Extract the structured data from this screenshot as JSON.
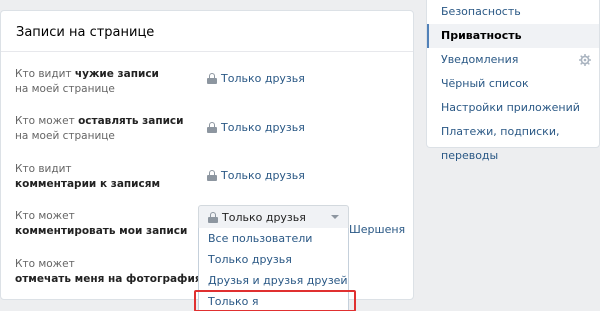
{
  "section": {
    "title": "Записи на странице"
  },
  "rows": [
    {
      "pre": "Кто видит ",
      "bold": "чужие записи",
      "post": "на моей странице",
      "value": "Только друзья"
    },
    {
      "pre": "Кто может ",
      "bold": "оставлять записи",
      "post": "на моей странице",
      "value": "Только друзья"
    },
    {
      "pre": "Кто видит",
      "bold": "комментарии к записям",
      "post": "",
      "value": "Только друзья"
    },
    {
      "pre": "Кто может",
      "bold": "комментировать мои записи",
      "post": "",
      "value": ""
    },
    {
      "pre": "Кто может",
      "bold": "отмечать меня на фотографиях",
      "post": "",
      "value": ""
    }
  ],
  "select": {
    "current": "Только друзья",
    "options": [
      "Все пользователи",
      "Только друзья",
      "Друзья и друзья друзей",
      "Только я"
    ],
    "highlighted_option": "Только я"
  },
  "behind_text": "Шершеня",
  "sidebar": {
    "items": [
      {
        "label": "Безопасность"
      },
      {
        "label": "Приватность",
        "active": true
      },
      {
        "label": "Уведомления"
      },
      {
        "label": "Чёрный список"
      },
      {
        "label": "Настройки приложений"
      },
      {
        "label": "Платежи, подписки, переводы"
      }
    ]
  },
  "colors": {
    "link": "#2a5885",
    "highlight_border": "#e03030",
    "active_indicator": "#5181b8"
  },
  "icons": {
    "lock": "lock-icon",
    "gear": "gear-icon",
    "caret": "chevron-down-icon"
  }
}
